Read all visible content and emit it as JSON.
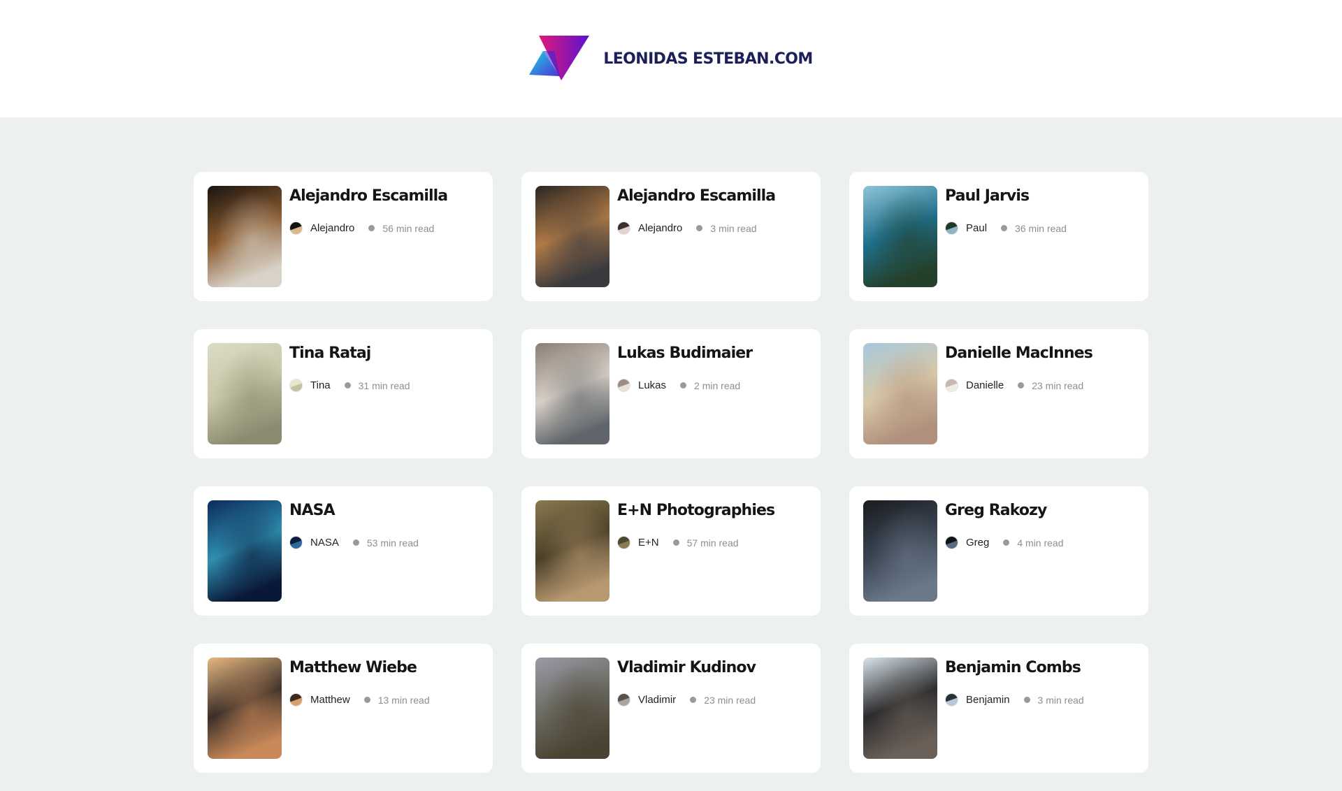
{
  "site": {
    "title": "LEONIDAS ESTEBAN.COM"
  },
  "cards": [
    {
      "title": "Alejandro Escamilla",
      "author": "Alejandro",
      "read_time": "56 min read",
      "image_icon": "laptop-photo",
      "colors": [
        "#1a1410",
        "#8a5a2e",
        "#d8d2c8"
      ],
      "avatar": [
        "#111111",
        "#d9b98c"
      ]
    },
    {
      "title": "Alejandro Escamilla",
      "author": "Alejandro",
      "read_time": "3 min read",
      "image_icon": "laptop-typing-photo",
      "colors": [
        "#2a2622",
        "#b07a46",
        "#3a3a3e"
      ],
      "avatar": [
        "#3a3030",
        "#e7d0d0"
      ]
    },
    {
      "title": "Paul Jarvis",
      "author": "Paul",
      "read_time": "36 min read",
      "image_icon": "forest-lake-photo",
      "colors": [
        "#8fc4d8",
        "#1e6f8c",
        "#24402a"
      ],
      "avatar": [
        "#1c3a28",
        "#8fb4c4"
      ]
    },
    {
      "title": "Tina Rataj",
      "author": "Tina",
      "read_time": "31 min read",
      "image_icon": "foggy-beach-photo",
      "colors": [
        "#dcdcc6",
        "#c8c6a8",
        "#8c8a70"
      ],
      "avatar": [
        "#e8e6cc",
        "#c4c2a0"
      ]
    },
    {
      "title": "Lukas Budimaier",
      "author": "Lukas",
      "read_time": "2 min read",
      "image_icon": "snow-dune-photo",
      "colors": [
        "#8a7e74",
        "#d8cfc6",
        "#5f656a"
      ],
      "avatar": [
        "#9a8e86",
        "#e8e2dc"
      ]
    },
    {
      "title": "Danielle MacInnes",
      "author": "Danielle",
      "read_time": "23 min read",
      "image_icon": "dune-path-photo",
      "colors": [
        "#a8c8dc",
        "#d8c8a8",
        "#b0907c"
      ],
      "avatar": [
        "#c8b8b0",
        "#f0ece8"
      ]
    },
    {
      "title": "NASA",
      "author": "NASA",
      "read_time": "53 min read",
      "image_icon": "earth-from-space-photo",
      "colors": [
        "#0c2a5a",
        "#2f8fb0",
        "#0a1838"
      ],
      "avatar": [
        "#0c1e3e",
        "#2e6aa0"
      ]
    },
    {
      "title": "E+N Photographies",
      "author": "E+N",
      "read_time": "57 min read",
      "image_icon": "deer-forest-photo",
      "colors": [
        "#8a7a50",
        "#4a4028",
        "#b89870"
      ],
      "avatar": [
        "#4a4a30",
        "#8a7a50"
      ]
    },
    {
      "title": "Greg Rakozy",
      "author": "Greg",
      "read_time": "4 min read",
      "image_icon": "night-couple-photo",
      "colors": [
        "#1a1c20",
        "#3a4452",
        "#6a7888"
      ],
      "avatar": [
        "#101418",
        "#5a6a80"
      ]
    },
    {
      "title": "Matthew Wiebe",
      "author": "Matthew",
      "read_time": "13 min read",
      "image_icon": "person-scarf-photo",
      "colors": [
        "#e8b880",
        "#3a2e28",
        "#c88858"
      ],
      "avatar": [
        "#3a2a20",
        "#d8a070"
      ]
    },
    {
      "title": "Vladimir Kudinov",
      "author": "Vladimir",
      "read_time": "23 min read",
      "image_icon": "misty-hill-photo",
      "colors": [
        "#9a9aa8",
        "#6a6a60",
        "#4a4232"
      ],
      "avatar": [
        "#5a5048",
        "#a8a4a0"
      ]
    },
    {
      "title": "Benjamin Combs",
      "author": "Benjamin",
      "read_time": "3 min read",
      "image_icon": "window-bed-photo",
      "colors": [
        "#d8e4ec",
        "#2a2a2c",
        "#6a6058"
      ],
      "avatar": [
        "#2a3038",
        "#b8c8d8"
      ]
    }
  ]
}
